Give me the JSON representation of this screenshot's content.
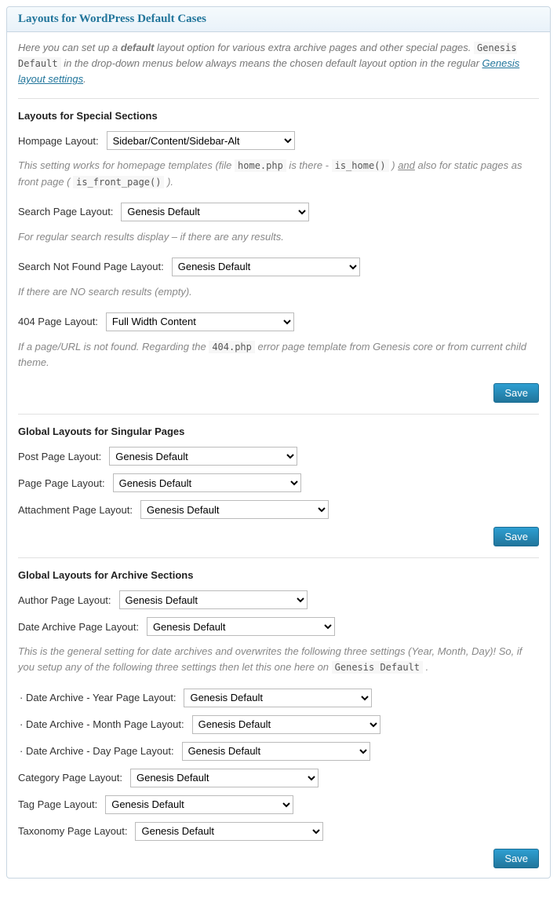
{
  "panel_title": "Layouts for WordPress Default Cases",
  "intro": {
    "part1": "Here you can set up a ",
    "default_word": "default",
    "part2": " layout option for various extra archive pages and other special pages. ",
    "code1": "Genesis Default",
    "part3": " in the drop-down menus below always means the chosen default layout option in the regular ",
    "link_text": "Genesis layout settings",
    "part4": "."
  },
  "save_label": "Save",
  "section_special": {
    "title": "Layouts for Special Sections",
    "homepage": {
      "label": "Hompage Layout:",
      "value": "Sidebar/Content/Sidebar-Alt",
      "help_pre": "This setting works for homepage templates (file ",
      "help_code1": "home.php",
      "help_mid1": " is there - ",
      "help_code2": "is_home()",
      "help_mid2": " ) ",
      "help_and": "and",
      "help_mid3": " also for static pages as front page ( ",
      "help_code3": "is_front_page()",
      "help_end": " )."
    },
    "search": {
      "label": "Search Page Layout:",
      "value": "Genesis Default",
      "help": "For regular search results display – if there are any results."
    },
    "search_not_found": {
      "label": "Search Not Found Page Layout:",
      "value": "Genesis Default",
      "help": "If there are NO search results (empty)."
    },
    "four04": {
      "label": "404 Page Layout:",
      "value": "Full Width Content",
      "help_pre": "If a page/URL is not found. Regarding the ",
      "help_code": "404.php",
      "help_post": " error page template from Genesis core or from current child theme."
    }
  },
  "section_singular": {
    "title": "Global Layouts for Singular Pages",
    "post": {
      "label": "Post Page Layout:",
      "value": "Genesis Default"
    },
    "page": {
      "label": "Page Page Layout:",
      "value": "Genesis Default"
    },
    "attachment": {
      "label": "Attachment Page Layout:",
      "value": "Genesis Default"
    }
  },
  "section_archive": {
    "title": "Global Layouts for Archive Sections",
    "author": {
      "label": "Author Page Layout:",
      "value": "Genesis Default"
    },
    "date": {
      "label": "Date Archive Page Layout:",
      "value": "Genesis Default",
      "help_pre": "This is the general setting for date archives and overwrites the following three settings (Year, Month, Day)! So, if you setup any of the following three settings then let this one here on ",
      "help_code": "Genesis Default",
      "help_post": " ."
    },
    "year": {
      "label": "Date Archive - Year Page Layout:",
      "value": "Genesis Default"
    },
    "month": {
      "label": "Date Archive - Month Page Layout:",
      "value": "Genesis Default"
    },
    "day": {
      "label": "Date Archive - Day Page Layout:",
      "value": "Genesis Default"
    },
    "category": {
      "label": "Category Page Layout:",
      "value": "Genesis Default"
    },
    "tag": {
      "label": "Tag Page Layout:",
      "value": "Genesis Default"
    },
    "taxonomy": {
      "label": "Taxonomy Page Layout:",
      "value": "Genesis Default"
    }
  }
}
